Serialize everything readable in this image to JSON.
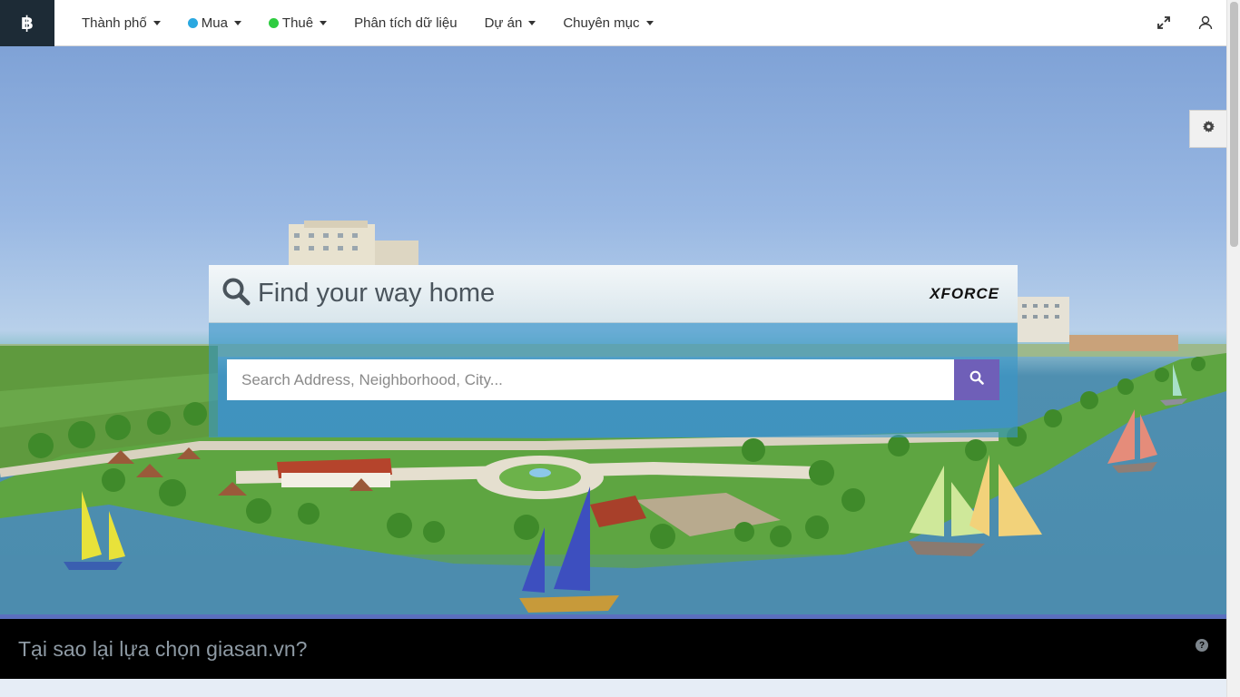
{
  "navbar": {
    "logo_glyph": "฿",
    "items": [
      {
        "label": "Thành phố",
        "dropdown": true
      },
      {
        "label": "Mua",
        "dropdown": true,
        "dot_color": "#2aa8e0"
      },
      {
        "label": "Thuê",
        "dropdown": true,
        "dot_color": "#2ecc40"
      },
      {
        "label": "Phân tích dữ liệu",
        "dropdown": false
      },
      {
        "label": "Dự án",
        "dropdown": true
      },
      {
        "label": "Chuyên mục",
        "dropdown": true
      }
    ],
    "right_icons": [
      "expand-icon",
      "user-icon"
    ]
  },
  "search": {
    "title": "Find your way home",
    "brand": "XFORCE",
    "placeholder": "Search Address, Neighborhood, City...",
    "button_icon": "search-icon"
  },
  "settings": {
    "icon": "gear-icon"
  },
  "why": {
    "text": "Tại sao lại lựa chọn giasan.vn?",
    "icon": "question-circle-icon"
  },
  "colors": {
    "accent": "#5b6fbe",
    "search_button": "#6f5fb8",
    "logo_bg": "#1d2b36"
  }
}
